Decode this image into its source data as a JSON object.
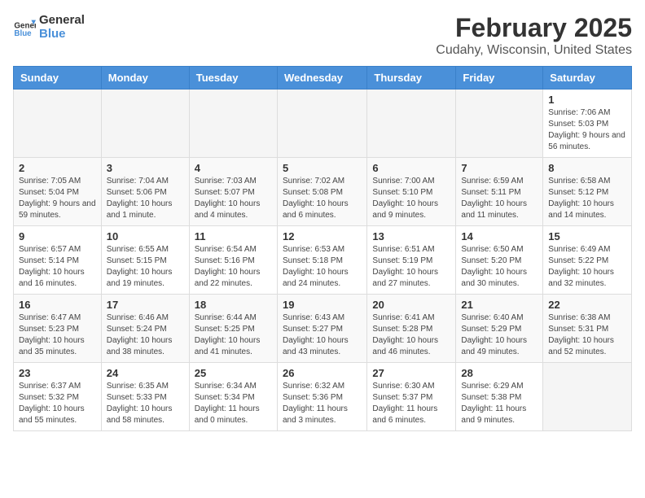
{
  "header": {
    "logo_general": "General",
    "logo_blue": "Blue",
    "month_title": "February 2025",
    "location": "Cudahy, Wisconsin, United States"
  },
  "weekdays": [
    "Sunday",
    "Monday",
    "Tuesday",
    "Wednesday",
    "Thursday",
    "Friday",
    "Saturday"
  ],
  "weeks": [
    [
      {
        "day": "",
        "info": ""
      },
      {
        "day": "",
        "info": ""
      },
      {
        "day": "",
        "info": ""
      },
      {
        "day": "",
        "info": ""
      },
      {
        "day": "",
        "info": ""
      },
      {
        "day": "",
        "info": ""
      },
      {
        "day": "1",
        "info": "Sunrise: 7:06 AM\nSunset: 5:03 PM\nDaylight: 9 hours and 56 minutes."
      }
    ],
    [
      {
        "day": "2",
        "info": "Sunrise: 7:05 AM\nSunset: 5:04 PM\nDaylight: 9 hours and 59 minutes."
      },
      {
        "day": "3",
        "info": "Sunrise: 7:04 AM\nSunset: 5:06 PM\nDaylight: 10 hours and 1 minute."
      },
      {
        "day": "4",
        "info": "Sunrise: 7:03 AM\nSunset: 5:07 PM\nDaylight: 10 hours and 4 minutes."
      },
      {
        "day": "5",
        "info": "Sunrise: 7:02 AM\nSunset: 5:08 PM\nDaylight: 10 hours and 6 minutes."
      },
      {
        "day": "6",
        "info": "Sunrise: 7:00 AM\nSunset: 5:10 PM\nDaylight: 10 hours and 9 minutes."
      },
      {
        "day": "7",
        "info": "Sunrise: 6:59 AM\nSunset: 5:11 PM\nDaylight: 10 hours and 11 minutes."
      },
      {
        "day": "8",
        "info": "Sunrise: 6:58 AM\nSunset: 5:12 PM\nDaylight: 10 hours and 14 minutes."
      }
    ],
    [
      {
        "day": "9",
        "info": "Sunrise: 6:57 AM\nSunset: 5:14 PM\nDaylight: 10 hours and 16 minutes."
      },
      {
        "day": "10",
        "info": "Sunrise: 6:55 AM\nSunset: 5:15 PM\nDaylight: 10 hours and 19 minutes."
      },
      {
        "day": "11",
        "info": "Sunrise: 6:54 AM\nSunset: 5:16 PM\nDaylight: 10 hours and 22 minutes."
      },
      {
        "day": "12",
        "info": "Sunrise: 6:53 AM\nSunset: 5:18 PM\nDaylight: 10 hours and 24 minutes."
      },
      {
        "day": "13",
        "info": "Sunrise: 6:51 AM\nSunset: 5:19 PM\nDaylight: 10 hours and 27 minutes."
      },
      {
        "day": "14",
        "info": "Sunrise: 6:50 AM\nSunset: 5:20 PM\nDaylight: 10 hours and 30 minutes."
      },
      {
        "day": "15",
        "info": "Sunrise: 6:49 AM\nSunset: 5:22 PM\nDaylight: 10 hours and 32 minutes."
      }
    ],
    [
      {
        "day": "16",
        "info": "Sunrise: 6:47 AM\nSunset: 5:23 PM\nDaylight: 10 hours and 35 minutes."
      },
      {
        "day": "17",
        "info": "Sunrise: 6:46 AM\nSunset: 5:24 PM\nDaylight: 10 hours and 38 minutes."
      },
      {
        "day": "18",
        "info": "Sunrise: 6:44 AM\nSunset: 5:25 PM\nDaylight: 10 hours and 41 minutes."
      },
      {
        "day": "19",
        "info": "Sunrise: 6:43 AM\nSunset: 5:27 PM\nDaylight: 10 hours and 43 minutes."
      },
      {
        "day": "20",
        "info": "Sunrise: 6:41 AM\nSunset: 5:28 PM\nDaylight: 10 hours and 46 minutes."
      },
      {
        "day": "21",
        "info": "Sunrise: 6:40 AM\nSunset: 5:29 PM\nDaylight: 10 hours and 49 minutes."
      },
      {
        "day": "22",
        "info": "Sunrise: 6:38 AM\nSunset: 5:31 PM\nDaylight: 10 hours and 52 minutes."
      }
    ],
    [
      {
        "day": "23",
        "info": "Sunrise: 6:37 AM\nSunset: 5:32 PM\nDaylight: 10 hours and 55 minutes."
      },
      {
        "day": "24",
        "info": "Sunrise: 6:35 AM\nSunset: 5:33 PM\nDaylight: 10 hours and 58 minutes."
      },
      {
        "day": "25",
        "info": "Sunrise: 6:34 AM\nSunset: 5:34 PM\nDaylight: 11 hours and 0 minutes."
      },
      {
        "day": "26",
        "info": "Sunrise: 6:32 AM\nSunset: 5:36 PM\nDaylight: 11 hours and 3 minutes."
      },
      {
        "day": "27",
        "info": "Sunrise: 6:30 AM\nSunset: 5:37 PM\nDaylight: 11 hours and 6 minutes."
      },
      {
        "day": "28",
        "info": "Sunrise: 6:29 AM\nSunset: 5:38 PM\nDaylight: 11 hours and 9 minutes."
      },
      {
        "day": "",
        "info": ""
      }
    ]
  ]
}
